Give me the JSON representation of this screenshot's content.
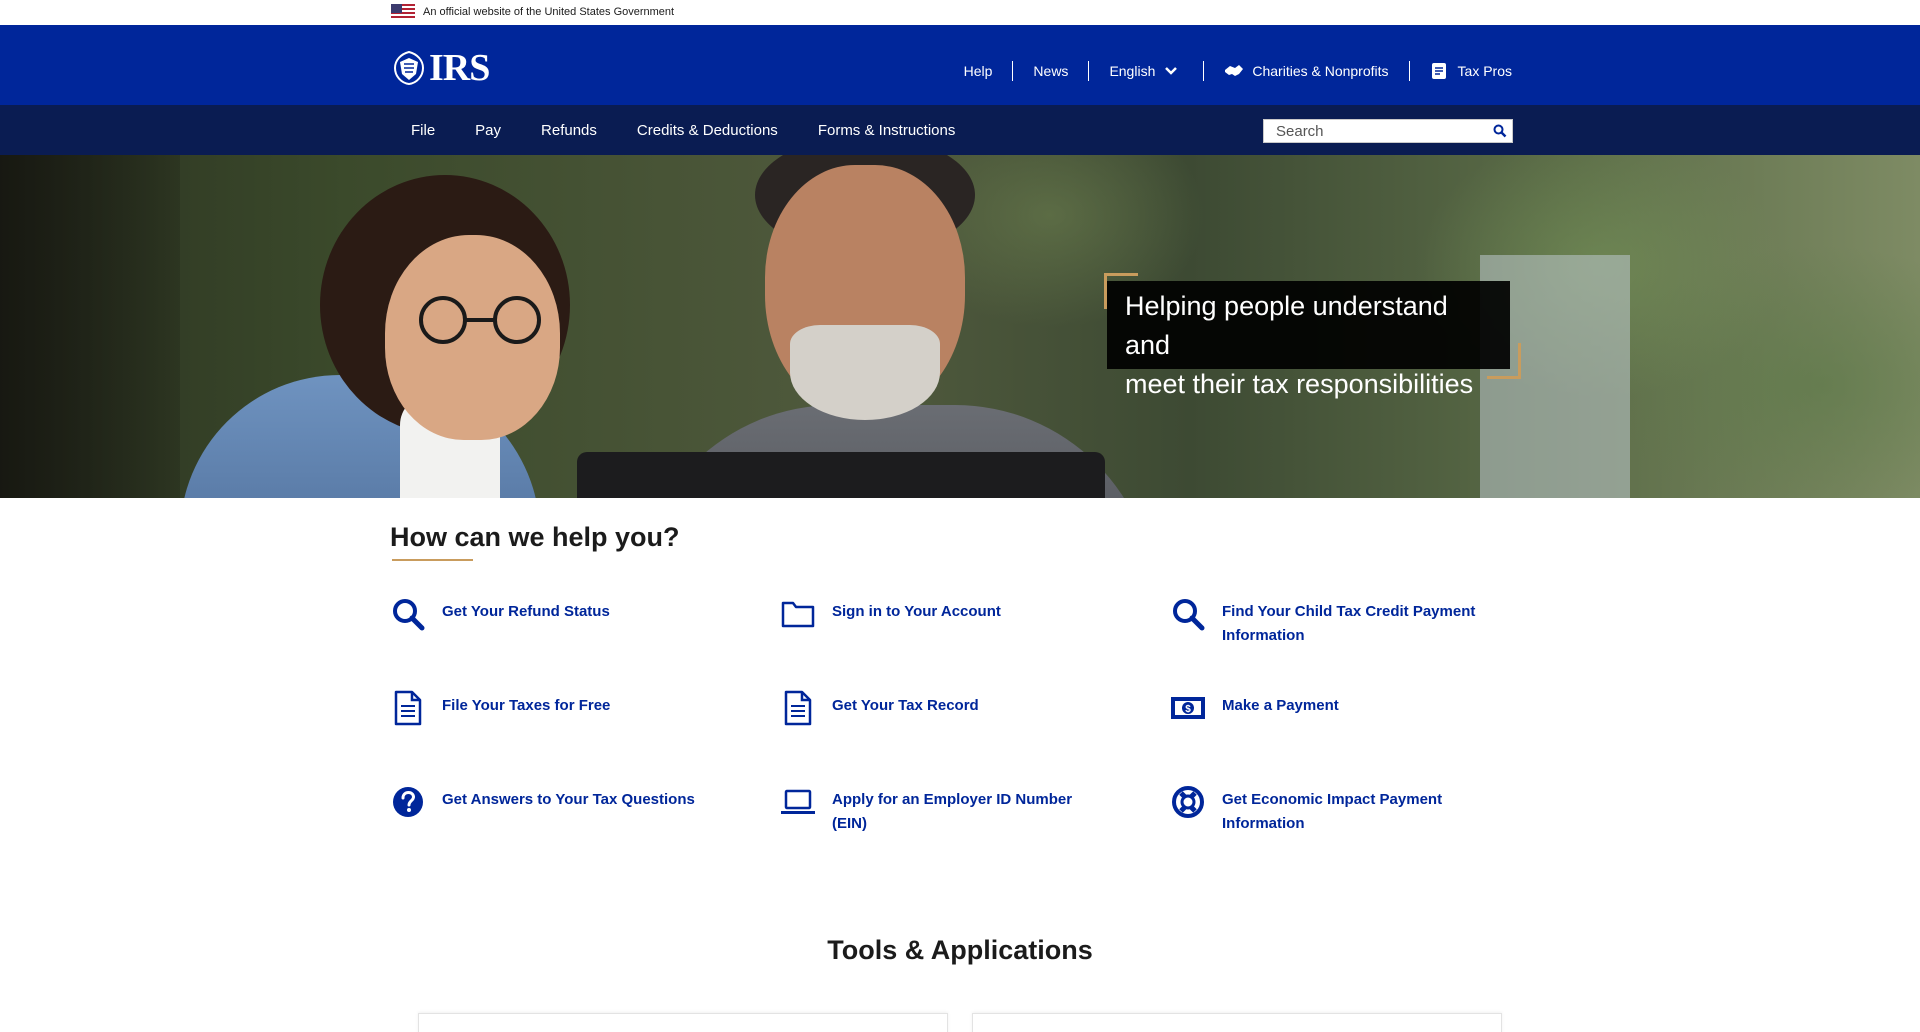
{
  "gov_banner": {
    "text": "An official website of the United States Government"
  },
  "header": {
    "logo_text": "IRS",
    "utility_nav": [
      {
        "label": "Help",
        "icon": ""
      },
      {
        "label": "News",
        "icon": ""
      },
      {
        "label": "English",
        "icon": "chevron-down-icon"
      },
      {
        "label": "Charities & Nonprofits",
        "icon": "handshake-icon"
      },
      {
        "label": "Tax Pros",
        "icon": "document-icon"
      }
    ]
  },
  "main_nav": {
    "items": [
      "File",
      "Pay",
      "Refunds",
      "Credits & Deductions",
      "Forms & Instructions"
    ],
    "search_placeholder": "Search"
  },
  "hero": {
    "tagline_line1": "Helping people understand and",
    "tagline_line2": "meet their tax responsibilities"
  },
  "help": {
    "title": "How can we help you?",
    "items": [
      {
        "label": "Get Your Refund Status",
        "icon": "search-icon"
      },
      {
        "label": "Sign in to Your Account",
        "icon": "folder-icon"
      },
      {
        "label": "Find Your Child Tax Credit Payment Information",
        "icon": "search-icon"
      },
      {
        "label": "File Your Taxes for Free",
        "icon": "document-icon"
      },
      {
        "label": "Get Your Tax Record",
        "icon": "document-icon"
      },
      {
        "label": "Make a Payment",
        "icon": "money-icon"
      },
      {
        "label": "Get Answers to Your Tax Questions",
        "icon": "question-icon"
      },
      {
        "label": "Apply for an Employer ID Number (EIN)",
        "icon": "laptop-icon"
      },
      {
        "label": "Get Economic Impact Payment Information",
        "icon": "lifebuoy-icon"
      }
    ]
  },
  "tools": {
    "title": "Tools & Applications"
  },
  "colors": {
    "header_blue": "#00269a",
    "nav_dark": "#0a1c52",
    "link_blue": "#00269a",
    "accent_gold": "#c99c5d"
  }
}
